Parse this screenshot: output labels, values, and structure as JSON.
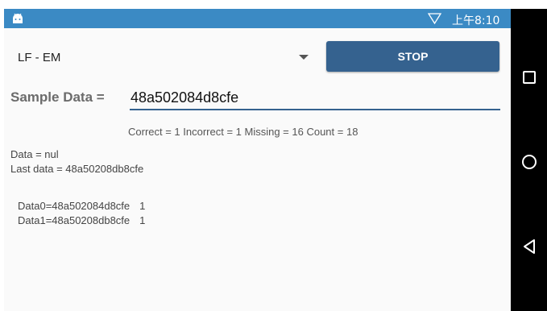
{
  "statusbar": {
    "time": "上午8:10"
  },
  "spinner": {
    "value": "LF - EM"
  },
  "stop_button": {
    "label": "STOP"
  },
  "sample": {
    "label": "Sample Data =",
    "value": "48a502084d8cfe"
  },
  "stats": {
    "text": "Correct = 1 Incorrect = 1 Missing = 16 Count = 18"
  },
  "info": {
    "data_line": "Data = nul",
    "last_data_line": "Last data = 48a50208db8cfe"
  },
  "list": [
    {
      "label": "Data0=48a502084d8cfe",
      "count": "1"
    },
    {
      "label": "Data1=48a50208db8cfe",
      "count": "1"
    }
  ],
  "colors": {
    "statusbar": "#3b8ac4",
    "button": "#35628f",
    "navbar": "#000000"
  },
  "icons": [
    "android-icon",
    "wifi-icon",
    "chevron-down-icon",
    "recents-icon",
    "home-icon",
    "back-icon"
  ]
}
